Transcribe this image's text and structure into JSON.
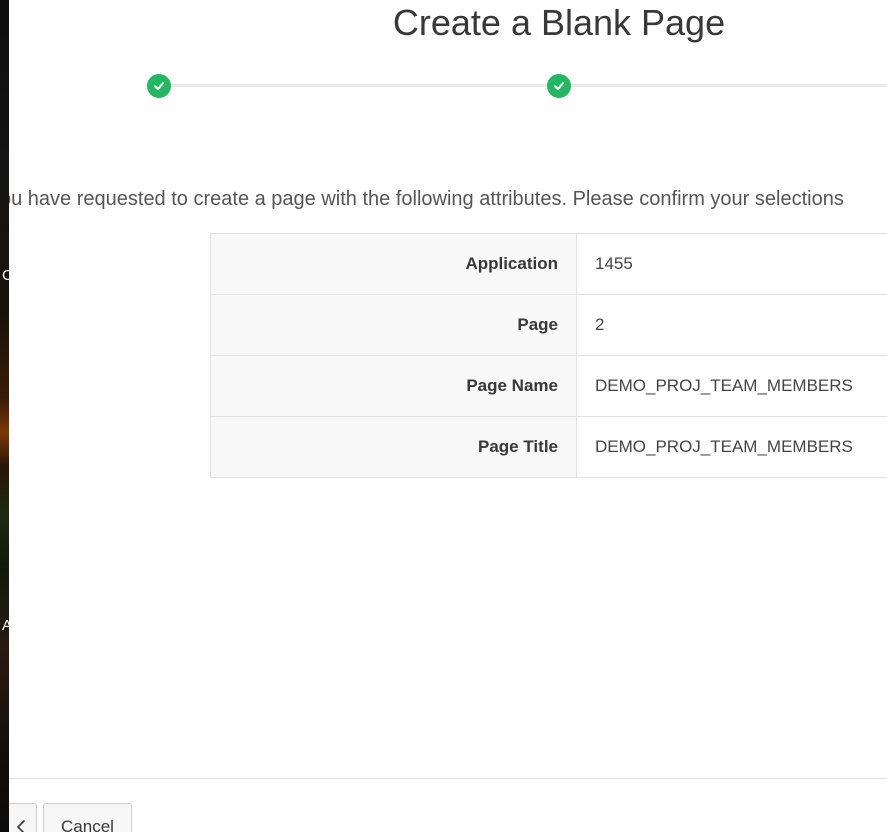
{
  "dialog": {
    "title": "Create a Blank Page"
  },
  "wizard": {
    "steps": [
      {
        "status": "complete",
        "icon": "check-icon"
      },
      {
        "status": "complete",
        "icon": "check-icon"
      }
    ],
    "accent_color": "#26b563"
  },
  "confirmation": {
    "intro_text": "ou have requested to create a page with the following attributes. Please confirm your selections"
  },
  "attributes": [
    {
      "label": "Application",
      "value": "1455"
    },
    {
      "label": "Page",
      "value": "2"
    },
    {
      "label": "Page Name",
      "value": "DEMO_PROJ_TEAM_MEMBERS"
    },
    {
      "label": "Page Title",
      "value": "DEMO_PROJ_TEAM_MEMBERS"
    }
  ],
  "footer": {
    "previous_icon": "chevron-left-icon",
    "cancel_label": "Cancel"
  },
  "background": {
    "glyph_1": "C",
    "glyph_2": "A"
  }
}
